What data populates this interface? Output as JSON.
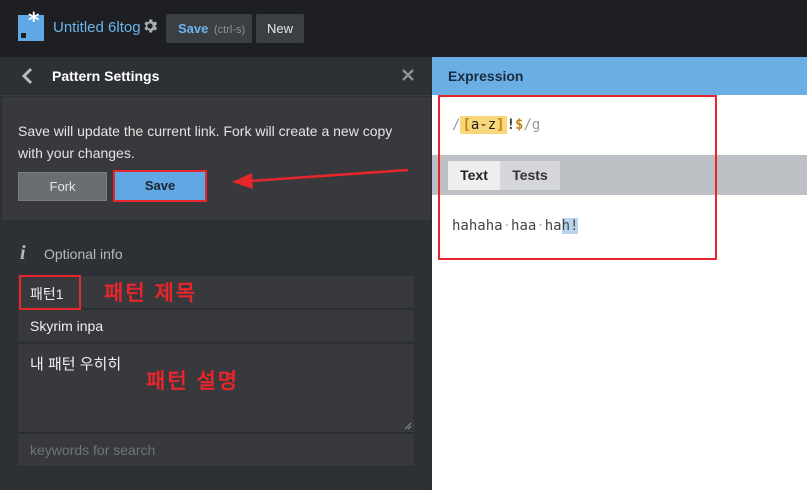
{
  "topbar": {
    "doc_title": "Untitled 6ltog",
    "save_label": "Save",
    "save_hint": "(ctrl-s)",
    "new_label": "New"
  },
  "panel": {
    "title": "Pattern Settings",
    "save_description": "Save will update the current link. Fork will create a new copy with your changes.",
    "fork_label": "Fork",
    "save_label": "Save",
    "optional_label": "Optional info",
    "name_value": "패턴1",
    "author_value": "Skyrim inpa",
    "description_value": "내 패턴 우히히",
    "keywords_placeholder": "keywords for search"
  },
  "annotations": {
    "name_note": "패턴 제목",
    "desc_note": "패턴 설명"
  },
  "expression": {
    "title": "Expression",
    "open_slash": "/",
    "class_open": "[",
    "class_body": "a-z",
    "class_close": "]",
    "literal": "!",
    "anchor": "$",
    "close_slash": "/",
    "flags": "g"
  },
  "tabs": {
    "text": "Text",
    "tests": "Tests"
  },
  "test": {
    "word1": "hahaha",
    "word2": "haa",
    "word3_plain": "ha",
    "word3_match": "h!"
  },
  "colors": {
    "accent": "#5fa8e4",
    "annotation_red": "#e6262a"
  }
}
